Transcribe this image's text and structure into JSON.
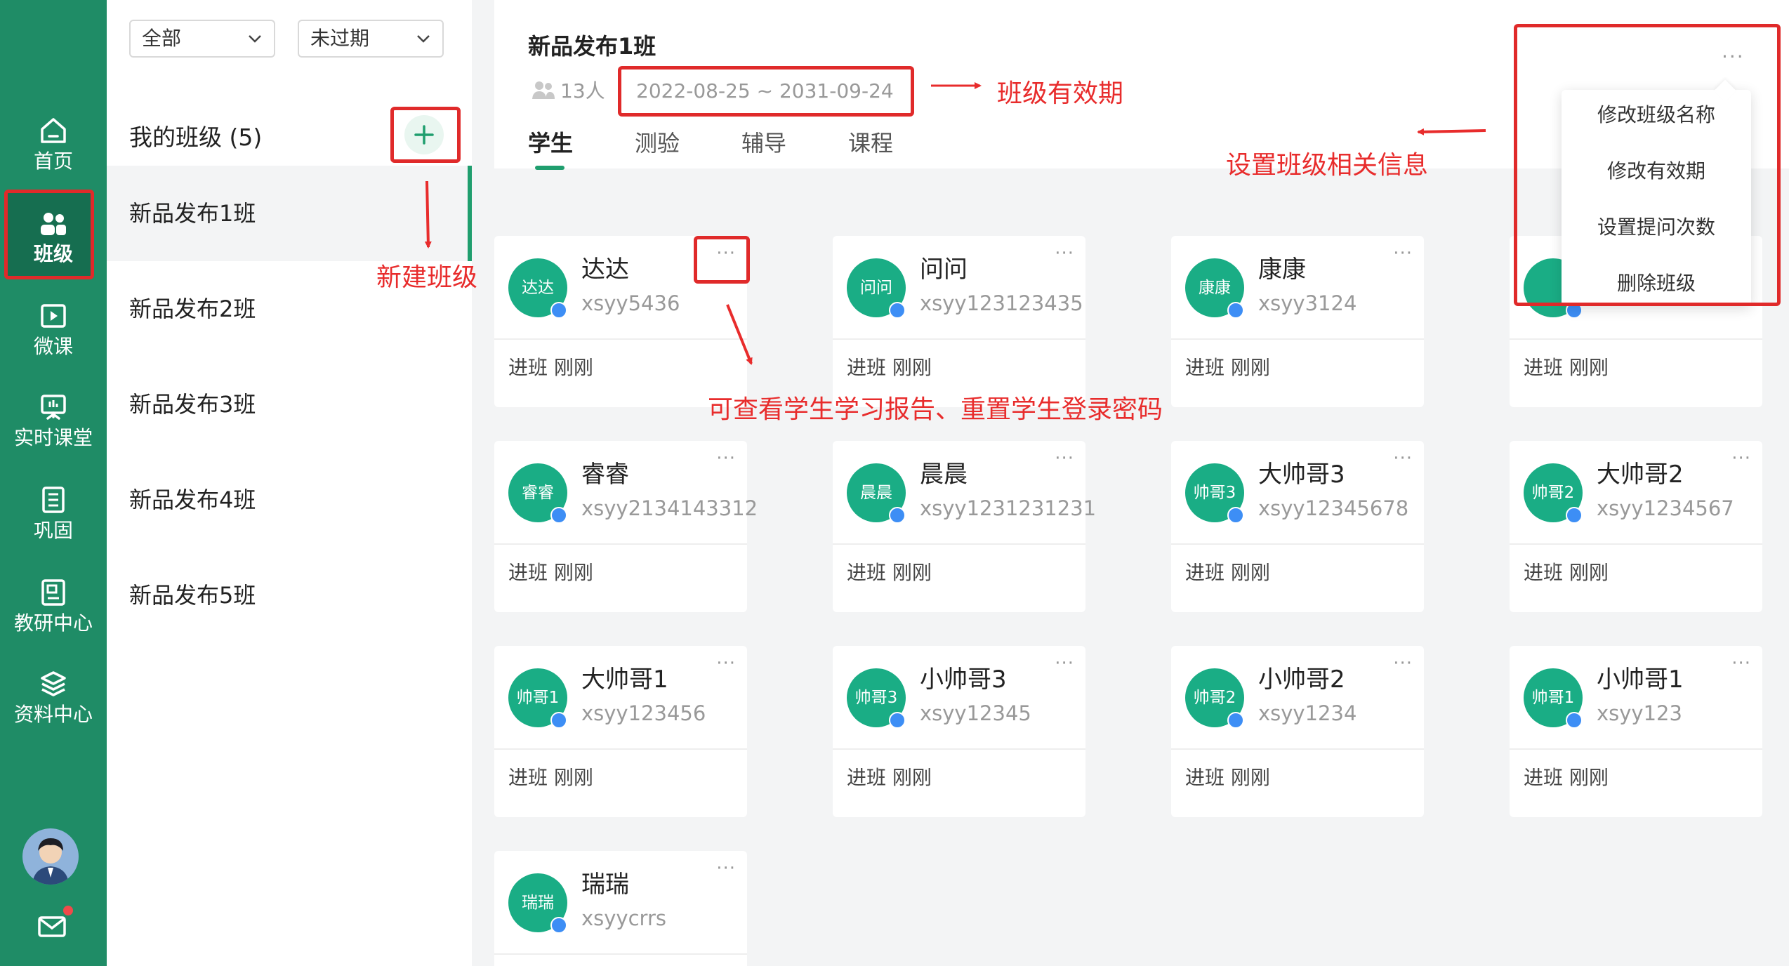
{
  "nav": {
    "items": [
      {
        "label": "首页",
        "icon": "home-icon"
      },
      {
        "label": "班级",
        "icon": "class-group-icon",
        "active": true
      },
      {
        "label": "微课",
        "icon": "video-lesson-icon"
      },
      {
        "label": "实时课堂",
        "icon": "live-classroom-icon"
      },
      {
        "label": "巩固",
        "icon": "practice-list-icon"
      },
      {
        "label": "教研中心",
        "icon": "research-center-icon"
      },
      {
        "label": "资料中心",
        "icon": "resource-layers-icon"
      }
    ],
    "avatar": "teacher-avatar",
    "mail_icon": "mail-icon"
  },
  "filters": {
    "scope": "全部",
    "status": "未过期"
  },
  "class_list": {
    "title": "我的班级 (5)",
    "add_icon": "plus-icon",
    "items": [
      "新品发布1班",
      "新品发布2班",
      "新品发布3班",
      "新品发布4班",
      "新品发布5班"
    ]
  },
  "header": {
    "class_name": "新品发布1班",
    "student_count": "13人",
    "validity": "2022-08-25 ~ 2031-09-24",
    "tabs": [
      "学生",
      "测验",
      "辅导",
      "课程"
    ]
  },
  "menu": {
    "trigger": "···",
    "items": [
      "修改班级名称",
      "修改有效期",
      "设置提问次数",
      "删除班级"
    ]
  },
  "students": [
    {
      "avatar_text": "达达",
      "name": "达达",
      "account": "xsyy5436",
      "status": "进班  刚刚"
    },
    {
      "avatar_text": "问问",
      "name": "问问",
      "account": "xsyy123123435",
      "status": "进班  刚刚"
    },
    {
      "avatar_text": "康康",
      "name": "康康",
      "account": "xsyy3124",
      "status": "进班  刚刚"
    },
    {
      "avatar_text": "",
      "name": "",
      "account": "",
      "status": "进班  刚刚"
    },
    {
      "avatar_text": "睿睿",
      "name": "睿睿",
      "account": "xsyy2134143312",
      "status": "进班  刚刚"
    },
    {
      "avatar_text": "晨晨",
      "name": "晨晨",
      "account": "xsyy1231231231",
      "status": "进班  刚刚"
    },
    {
      "avatar_text": "帅哥3",
      "name": "大帅哥3",
      "account": "xsyy12345678",
      "status": "进班  刚刚"
    },
    {
      "avatar_text": "帅哥2",
      "name": "大帅哥2",
      "account": "xsyy1234567",
      "status": "进班  刚刚"
    },
    {
      "avatar_text": "帅哥1",
      "name": "大帅哥1",
      "account": "xsyy123456",
      "status": "进班  刚刚"
    },
    {
      "avatar_text": "帅哥3",
      "name": "小帅哥3",
      "account": "xsyy12345",
      "status": "进班  刚刚"
    },
    {
      "avatar_text": "帅哥2",
      "name": "小帅哥2",
      "account": "xsyy1234",
      "status": "进班  刚刚"
    },
    {
      "avatar_text": "帅哥1",
      "name": "小帅哥1",
      "account": "xsyy123",
      "status": "进班  刚刚"
    },
    {
      "avatar_text": "瑞瑞",
      "name": "瑞瑞",
      "account": "xsyycrrs",
      "status": ""
    }
  ],
  "card_more": "···",
  "annotations": {
    "validity": "班级有效期",
    "menu": "设置班级相关信息",
    "new_class": "新建班级",
    "card_more": "可查看学生学习报告、重置学生登录密码"
  },
  "colors": {
    "brand_green": "#1f8c66",
    "avatar_green": "#1aad85",
    "annotation_red": "#e82c2c",
    "badge_blue": "#3d8ef5"
  }
}
